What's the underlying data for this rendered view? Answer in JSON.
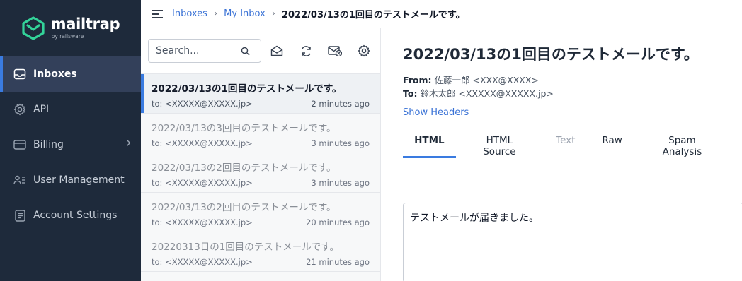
{
  "brand": {
    "name": "mailtrap",
    "sub": "by railsware",
    "accent": "#3a7be0",
    "sidebar_bg": "#1e2a3b",
    "logo_color": "#33d399"
  },
  "sidebar": {
    "items": [
      {
        "label": "Inboxes",
        "icon": "inbox-icon",
        "active": true
      },
      {
        "label": "API",
        "icon": "gear-icon",
        "active": false
      },
      {
        "label": "Billing",
        "icon": "credit-card-icon",
        "active": false,
        "has_chevron": true
      },
      {
        "label": "User Management",
        "icon": "users-icon",
        "active": false
      },
      {
        "label": "Account Settings",
        "icon": "document-icon",
        "active": false
      }
    ]
  },
  "topbar": {
    "breadcrumb": [
      "Inboxes",
      "My Inbox"
    ],
    "sep": "›",
    "current": "2022/03/13の1回目のテストメールです。"
  },
  "list": {
    "search_placeholder": "Search...",
    "toolbar_icons": [
      "mark-read-icon",
      "refresh-icon",
      "clear-inbox-icon",
      "settings-icon"
    ],
    "messages": [
      {
        "subject": "2022/03/13の1回目のテストメールです。",
        "to": "to: <XXXXX@XXXXX.jp>",
        "time": "2 minutes ago",
        "active": true
      },
      {
        "subject": "2022/03/13の3回目のテストメールです。",
        "to": "to: <XXXXX@XXXXX.jp>",
        "time": "3 minutes ago",
        "active": false
      },
      {
        "subject": "2022/03/13の2回目のテストメールです。",
        "to": "to: <XXXXX@XXXXX.jp>",
        "time": "3 minutes ago",
        "active": false
      },
      {
        "subject": "2022/03/13の2回目のテストメールです。",
        "to": "to: <XXXXX@XXXXX.jp>",
        "time": "20 minutes ago",
        "active": false
      },
      {
        "subject": "20220313日の1回目のテストメールです。",
        "to": "to: <XXXXX@XXXXX.jp>",
        "time": "21 minutes ago",
        "active": false
      }
    ]
  },
  "detail": {
    "title": "2022/03/13の1回目のテストメールです。",
    "from_label": "From:",
    "from_value": "佐藤一郎 <XXX@XXXX>",
    "to_label": "To:",
    "to_value": "鈴木太郎 <XXXXX@XXXXX.jp>",
    "show_headers": "Show Headers",
    "tabs": [
      {
        "label": "HTML",
        "active": true
      },
      {
        "label": "HTML Source"
      },
      {
        "label": "Text",
        "disabled": true
      },
      {
        "label": "Raw"
      },
      {
        "label": "Spam Analysis"
      }
    ],
    "body": "テストメールが届きました。"
  }
}
